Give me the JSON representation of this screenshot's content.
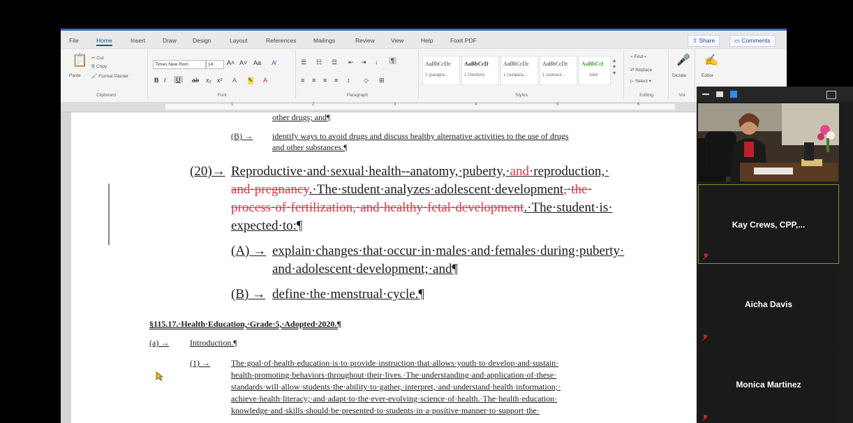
{
  "word": {
    "menu": [
      "File",
      "Home",
      "Insert",
      "Draw",
      "Design",
      "Layout",
      "References",
      "Mailings",
      "Review",
      "View",
      "Help",
      "Foxit PDF"
    ],
    "share_label": "Share",
    "comments_label": "Comments",
    "ribbon": {
      "clipboard": {
        "paste": "Paste",
        "cut": "Cut",
        "copy": "Copy",
        "format_painter": "Format Painter",
        "group": "Clipboard"
      },
      "font": {
        "name": "Times New Rom",
        "size": "14",
        "group": "Font"
      },
      "paragraph": {
        "group": "Paragraph"
      },
      "styles": {
        "items": [
          {
            "sample": "AaBbCcDc",
            "name": "1 (paragra..."
          },
          {
            "sample": "AaBbCcD",
            "name": "1 (Section)"
          },
          {
            "sample": "AaBbCcDc",
            "name": "1 (subpara..."
          },
          {
            "sample": "AaBbCcDc",
            "name": "1 (subsect..."
          },
          {
            "sample": "AaBbCcl",
            "name": "Addi"
          }
        ],
        "group": "Styles"
      },
      "editing": {
        "find": "Find",
        "replace": "Replace",
        "select": "Select",
        "group": "Editing"
      },
      "voice": {
        "dictate": "Dictate",
        "group": "Voi"
      },
      "editor": {
        "label": "Editor"
      }
    },
    "ruler_numbers": [
      "1",
      "2",
      "3",
      "4",
      "5",
      "6"
    ]
  },
  "document": {
    "line_drugs": "other drugs; and¶",
    "b_drugs_label": "(B) →",
    "b_drugs_1": "identify ways to avoid drugs and discuss healthy alternative activities to the use of drugs",
    "b_drugs_2": "and other substances.¶",
    "item20_label": "(20)→",
    "item20_a": "Reproductive·and·sexual·health--anatomy,·puberty,·",
    "item20_a_red": "and",
    "item20_a_end": "·reproduction,·",
    "item20_b_red": "and·pregnancy",
    "item20_b": ".·The·student·analyzes·adolescent·development",
    "item20_b_red2": ",·the·",
    "item20_c_red": "process·of·fertilization,·and·healthy·fetal·development",
    "item20_c": ".·The·student·is·",
    "item20_d": "expected·to:¶",
    "a_label": "(A) →",
    "a_1": "explain·changes·that·occur·in·males·and·females·during·puberty·",
    "a_2": "and·adolescent·development;·and¶",
    "b_label": "(B) →",
    "b_1": "define·the·menstrual·cycle.¶",
    "section_title": "§115.17.·Health·Education,·Grade·5,·Adopted·2020.¶",
    "intro_label": "(a) →",
    "intro": "Introduction.¶",
    "p1_label": "(1) →",
    "p1_1": "The·goal·of·health·education·is·to·provide·instruction·that·allows·youth·to·develop·and·sustain·",
    "p1_2": "health-promoting·behaviors·throughout·their·lives.·The·understanding·and·application·of·these·",
    "p1_3": "standards·will·allow·students·the·ability·to·gather,·interpret,·and·understand·health·information;·",
    "p1_4": "achieve·health·literacy;·and·adapt·to·the·ever-evolving·science·of·health.·The·health·education·",
    "p1_5": "knowledge·and·skills·should·be·presented·to·students·in·a·positive·manner·to·support·the·"
  },
  "zoom": {
    "participants": [
      "Kay Crews, CPP,...",
      "Aicha Davis",
      "Monica Martinez"
    ],
    "colors": {
      "active_border": "#7a9a2a",
      "muted": "#d02020"
    }
  }
}
